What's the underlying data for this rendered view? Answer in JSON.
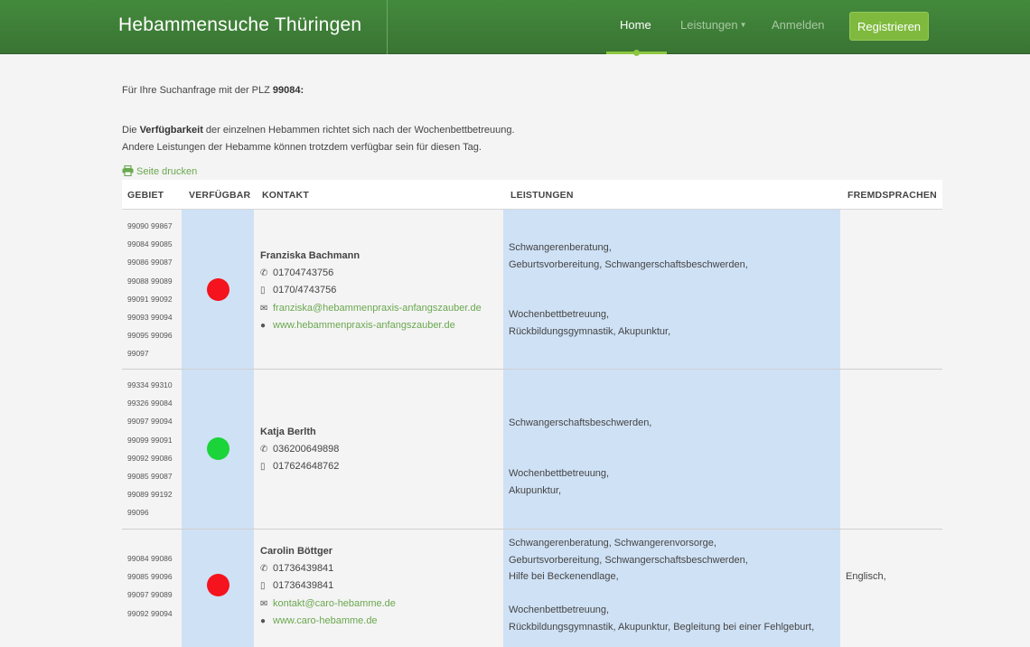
{
  "nav": {
    "brand": "Hebammensuche Thüringen",
    "home": "Home",
    "leistungen": "Leistungen",
    "anmelden": "Anmelden",
    "registrieren": "Registrieren"
  },
  "intro": {
    "line1_prefix": "Für Ihre Suchanfrage mit der PLZ ",
    "plz": "99084:",
    "line2_prefix": "Die ",
    "line2_bold": "Verfügbarkeit",
    "line2_suffix": " der einzelnen Hebammen richtet sich nach der Wochenbettbetreuung.",
    "line3": "Andere Leistungen der Hebamme können trotzdem verfügbar sein für diesen Tag.",
    "print": "Seite drucken"
  },
  "table": {
    "headers": [
      "GEBIET",
      "VERFÜGBAR",
      "KONTAKT",
      "LEISTUNGEN",
      "FREMDSPRACHEN"
    ],
    "rows": [
      {
        "plz": [
          "99090 99867",
          "99084 99085",
          "99086 99087",
          "99088 99089",
          "99091 99092",
          "99093 99094",
          "99095 99096",
          "99097"
        ],
        "status_color": "#f5131d",
        "name": "Franziska Bachmann",
        "phone": "01704743756",
        "mobile": "0170/4743756",
        "email": "franziska@hebammenpraxis-anfangszauber.de",
        "web": "www.hebammenpraxis-anfangszauber.de",
        "leist_a": [
          "Schwangerenberatung,",
          "Geburtsvorbereitung, Schwangerschaftsbeschwerden,"
        ],
        "leist_b": [
          "Wochenbettbetreuung,",
          "Rückbildungsgymnastik, Akupunktur,"
        ],
        "sprachen": ""
      },
      {
        "plz": [
          "99334 99310",
          "99326 99084",
          "99097 99094",
          "99099 99091",
          "99092 99086",
          "99085 99087",
          "99089 99192",
          "99096"
        ],
        "status_color": "#1ad43a",
        "name": "Katja Berlth",
        "phone": "036200649898",
        "mobile": "01762464876​2",
        "leist_a": [
          "Schwangerschaftsbeschwerden,"
        ],
        "leist_b": [
          "Wochenbettbetreuung,",
          "Akupunktur,"
        ],
        "sprachen": ""
      },
      {
        "plz": [
          "99084 99086",
          "99085 99096",
          "99097 99089",
          "99092 99094"
        ],
        "status_color": "#f5131d",
        "name": "Carolin Böttger",
        "phone": "01736439841",
        "mobile": "01736439841",
        "email": "kontakt@caro-hebamme.de",
        "web": "www.caro-hebamme.de",
        "leist_a": [
          "Schwangerenberatung, Schwangerenvorsorge,",
          "Geburtsvorbereitung, Schwangerschaftsbeschwerden,",
          "Hilfe bei Beckenendlage,"
        ],
        "leist_b": [
          "Wochenbettbetreuung,",
          "Rückbildungsgymnastik, Akupunktur, Begleitung bei einer Fehlgeburt,"
        ],
        "sprachen": "Englisch,"
      }
    ]
  },
  "colors": {
    "nav_bg": "#3f7d3a",
    "accent": "#7fba3f",
    "cell_blue": "#cfe1f5",
    "link": "#6aa84f"
  }
}
